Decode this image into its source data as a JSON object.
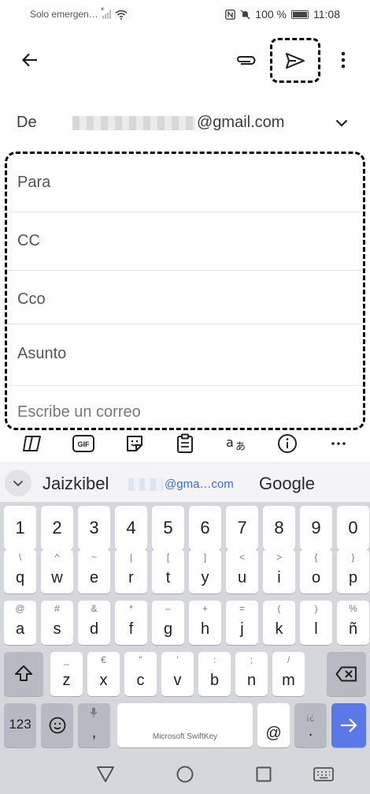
{
  "status_bar": {
    "carrier": "Solo emergen…",
    "battery": "100 %",
    "time": "11:08"
  },
  "compose": {
    "from_label": "De",
    "from_email_suffix": "@gmail.com",
    "to_placeholder": "Para",
    "cc_placeholder": "CC",
    "bcc_placeholder": "Cco",
    "subject_placeholder": "Asunto",
    "body_placeholder": "Escribe un correo"
  },
  "keyboard": {
    "toolbar_gif": "GIF",
    "suggestions": [
      "Jaizkibel",
      "@gma…com",
      "Google"
    ],
    "space_label": "Microsoft SwiftKey",
    "row_numbers": [
      "1",
      "2",
      "3",
      "4",
      "5",
      "6",
      "7",
      "8",
      "9",
      "0"
    ],
    "row1": [
      {
        "main": "q",
        "alt": "\\"
      },
      {
        "main": "w",
        "alt": "^"
      },
      {
        "main": "e",
        "alt": "~"
      },
      {
        "main": "r",
        "alt": "|"
      },
      {
        "main": "t",
        "alt": "["
      },
      {
        "main": "y",
        "alt": "]"
      },
      {
        "main": "u",
        "alt": "<"
      },
      {
        "main": "i",
        "alt": ">"
      },
      {
        "main": "o",
        "alt": "{"
      },
      {
        "main": "p",
        "alt": "}"
      }
    ],
    "row2": [
      {
        "main": "a",
        "alt": "@"
      },
      {
        "main": "s",
        "alt": "#"
      },
      {
        "main": "d",
        "alt": "&"
      },
      {
        "main": "f",
        "alt": "*"
      },
      {
        "main": "g",
        "alt": "–"
      },
      {
        "main": "h",
        "alt": "+"
      },
      {
        "main": "j",
        "alt": "="
      },
      {
        "main": "k",
        "alt": "("
      },
      {
        "main": "l",
        "alt": ")"
      },
      {
        "main": "ñ",
        "alt": "%"
      }
    ],
    "row3": [
      {
        "main": "z",
        "alt": "_"
      },
      {
        "main": "x",
        "alt": "€"
      },
      {
        "main": "c",
        "alt": "\""
      },
      {
        "main": "v",
        "alt": "'"
      },
      {
        "main": "b",
        "alt": ":"
      },
      {
        "main": "n",
        "alt": ";"
      },
      {
        "main": "m",
        "alt": "/"
      }
    ],
    "num_switch": "123",
    "comma": ",",
    "at": "@",
    "period": ".",
    "period_alt": "¡¿",
    "accent_color": "#5a78e8"
  }
}
